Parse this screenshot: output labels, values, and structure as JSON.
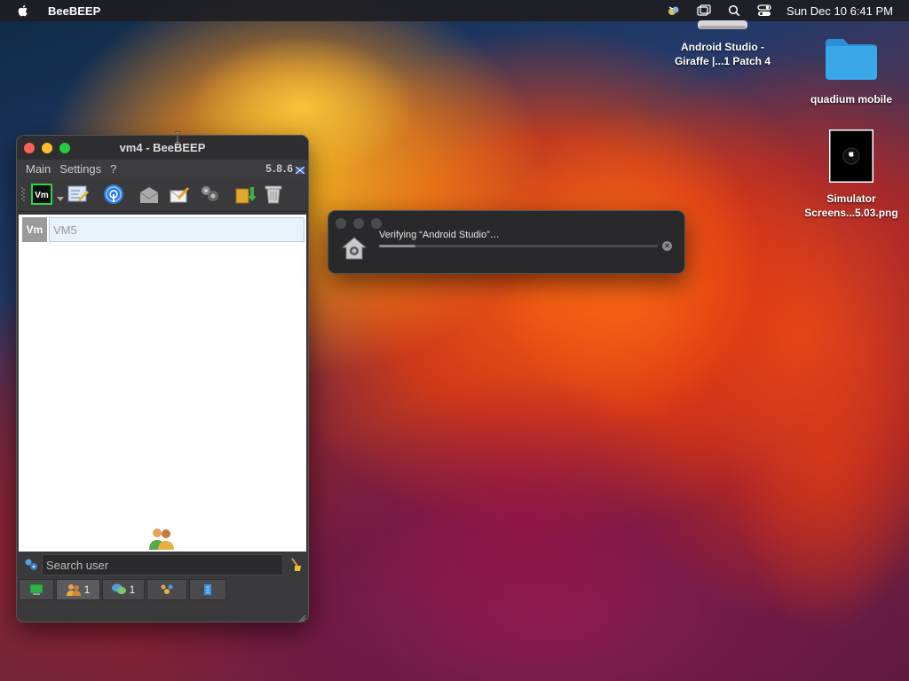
{
  "menubar": {
    "app_name": "BeeBEEP",
    "clock": "Sun Dec 10  6:41 PM",
    "icons": [
      "apple-icon",
      "beebeep-status-icon",
      "window-switch-icon",
      "spotlight-search-icon",
      "control-center-icon"
    ]
  },
  "desktop": {
    "items": [
      {
        "label": "Android Studio - Giraffe |...1 Patch 4",
        "icon": "disk-image-icon"
      },
      {
        "label": "quadium mobile",
        "icon": "folder-icon"
      },
      {
        "label": "Simulator Screens...5.03.png",
        "icon": "image-file-icon"
      }
    ]
  },
  "beebeep": {
    "title": "vm4 - BeeBEEP",
    "menu": [
      "Main",
      "Settings",
      "?"
    ],
    "version": "5.8.6",
    "user": {
      "tag": "Vm",
      "name": "VM5"
    },
    "search": {
      "placeholder": "Search user"
    },
    "tabs": [
      {
        "label": "",
        "icon": "screen-icon"
      },
      {
        "label": "1",
        "icon": "users-icon"
      },
      {
        "label": "1",
        "icon": "chats-icon"
      },
      {
        "label": "",
        "icon": "groups-icon"
      },
      {
        "label": "",
        "icon": "files-icon"
      }
    ]
  },
  "verify_dialog": {
    "label": "Verifying “Android Studio”…",
    "progress": 0.13
  },
  "colors": {
    "traffic_red": "#fe5f57",
    "traffic_yellow": "#febc2e",
    "traffic_green": "#28c840",
    "folder_blue": "#3aa7e8"
  }
}
